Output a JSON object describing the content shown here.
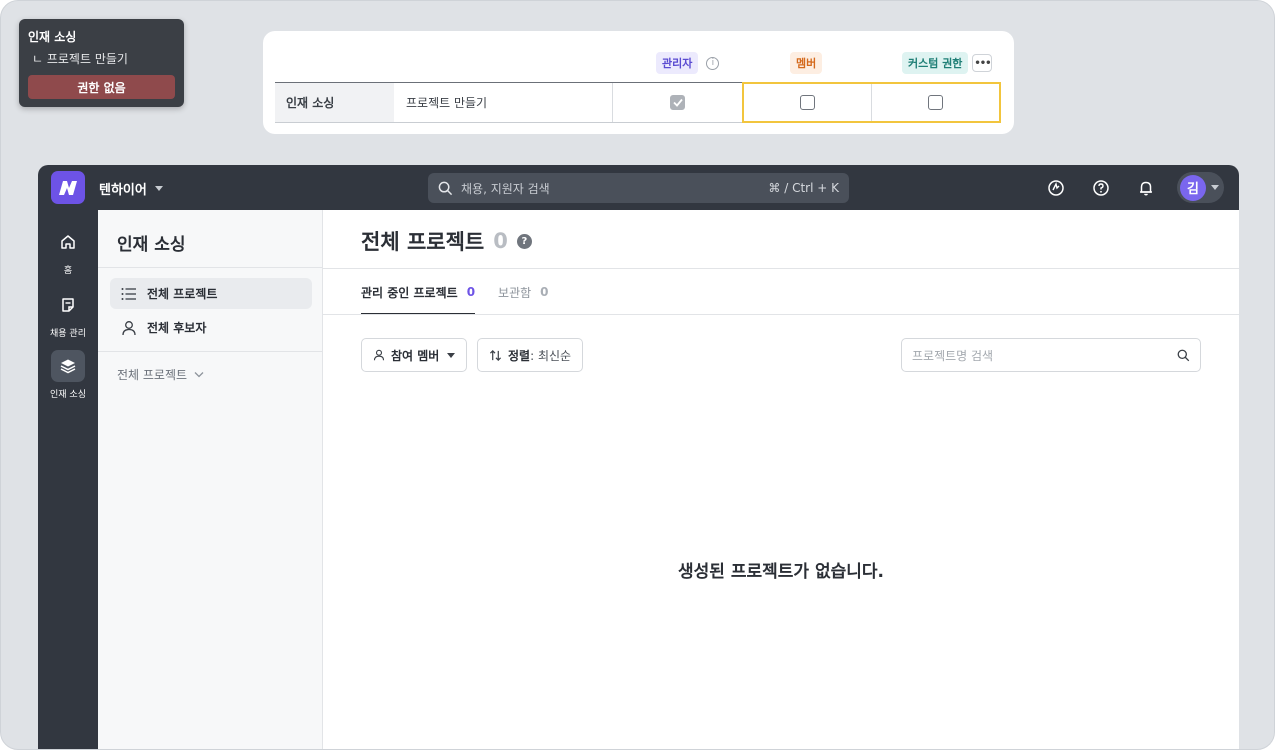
{
  "tooltip": {
    "title": "인재 소싱",
    "subtitle": "ㄴ 프로젝트 만들기",
    "badge": "권한 없음"
  },
  "permission_table": {
    "headers": {
      "admin": "관리자",
      "member": "멤버",
      "custom": "커스텀 권한"
    },
    "row": {
      "category": "인재 소싱",
      "permission": "프로젝트 만들기",
      "admin_checked": true,
      "member_checked": false,
      "custom_checked": false
    },
    "colors": {
      "admin_chip": "#5a4bd1",
      "member_chip": "#d46a1d",
      "custom_chip": "#1f7f76",
      "highlight": "#f2c53d"
    }
  },
  "topbar": {
    "workspace": "텐하이어",
    "search_placeholder": "채용, 지원자 검색",
    "search_shortcut": "⌘ / Ctrl + K",
    "avatar_initial": "김",
    "icons": [
      "chat-icon",
      "help-icon",
      "bell-icon"
    ]
  },
  "rail": {
    "items": [
      {
        "label": "홈",
        "icon": "home-icon"
      },
      {
        "label": "채용 관리",
        "icon": "note-icon"
      },
      {
        "label": "인재 소싱",
        "icon": "layers-icon",
        "active": true
      }
    ]
  },
  "subnav": {
    "title": "인재 소싱",
    "items": [
      {
        "label": "전체 프로젝트",
        "icon": "list-icon",
        "active": true
      },
      {
        "label": "전체 후보자",
        "icon": "person-icon"
      }
    ],
    "group_label": "전체 프로젝트"
  },
  "main": {
    "title": "전체 프로젝트",
    "count": "0",
    "tabs": [
      {
        "label": "관리 중인 프로젝트",
        "count": "0",
        "active": true
      },
      {
        "label": "보관함",
        "count": "0"
      }
    ],
    "filters": {
      "member_label": "참여 멤버",
      "sort_label": "정렬",
      "sort_value": " : 최신순"
    },
    "search_placeholder": "프로젝트명 검색",
    "empty_message": "생성된 프로젝트가 없습니다."
  }
}
